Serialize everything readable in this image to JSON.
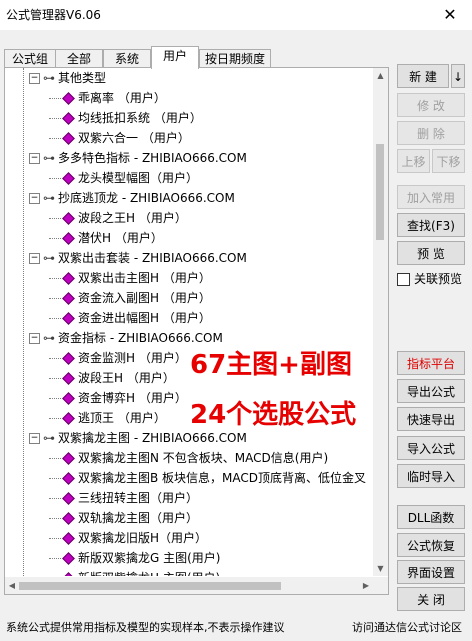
{
  "window": {
    "title": "公式管理器V6.06",
    "close_glyph": "✕"
  },
  "tabs": [
    "公式组",
    "全部",
    "系统",
    "用户",
    "按日期频度"
  ],
  "active_tab": "用户",
  "tree": [
    {
      "type": "group",
      "label": "其他类型"
    },
    {
      "type": "item",
      "label": "乖离率 （用户）"
    },
    {
      "type": "item",
      "label": "均线抵扣系统 （用户）"
    },
    {
      "type": "item",
      "label": "双紫六合一 （用户）"
    },
    {
      "type": "group",
      "label": "多多特色指标 - ZHIBIAO666.COM"
    },
    {
      "type": "item",
      "label": "龙头模型幅图（用户）"
    },
    {
      "type": "group",
      "label": "抄底逃顶龙 - ZHIBIAO666.COM"
    },
    {
      "type": "item",
      "label": "波段之王H （用户）"
    },
    {
      "type": "item",
      "label": "潜伏H （用户）"
    },
    {
      "type": "group",
      "label": "双紫出击套装 - ZHIBIAO666.COM"
    },
    {
      "type": "item",
      "label": "双紫出击主图H （用户）"
    },
    {
      "type": "item",
      "label": "资金流入副图H （用户）"
    },
    {
      "type": "item",
      "label": "资金进出幅图H （用户）"
    },
    {
      "type": "group",
      "label": "资金指标 - ZHIBIAO666.COM"
    },
    {
      "type": "item",
      "label": "资金监测H （用户）"
    },
    {
      "type": "item",
      "label": "波段王H （用户）"
    },
    {
      "type": "item",
      "label": "资金博弈H （用户）"
    },
    {
      "type": "item",
      "label": "逃顶王 （用户）"
    },
    {
      "type": "group",
      "label": "双紫擒龙主图 - ZHIBIAO666.COM"
    },
    {
      "type": "item",
      "label": "双紫擒龙主图N  不包含板块、MACD信息(用户)"
    },
    {
      "type": "item",
      "label": "双紫擒龙主图B  板块信息，MACD顶底背离、低位金叉"
    },
    {
      "type": "item",
      "label": "三线扭转主图（用户）"
    },
    {
      "type": "item",
      "label": "双轨擒龙主图（用户）"
    },
    {
      "type": "item",
      "label": "双紫擒龙旧版H（用户）"
    },
    {
      "type": "item",
      "label": "新版双紫擒龙G 主图(用户)"
    },
    {
      "type": "item",
      "label": "新版双紫擒龙H 主图(用户)"
    }
  ],
  "buttons": {
    "new": "新 建",
    "new_arrow": "↓",
    "modify": "修 改",
    "delete": "删 除",
    "move_up": "上移",
    "move_down": "下移",
    "add_common": "加入常用",
    "find": "查找(F3)",
    "preview": "预 览",
    "link_preview": "关联预览",
    "indicator_platform": "指标平台",
    "export": "导出公式",
    "quick_export": "快速导出",
    "import": "导入公式",
    "temp_import": "临时导入",
    "dll": "DLL函数",
    "restore": "公式恢复",
    "ui_settings": "界面设置",
    "close": "关 闭"
  },
  "overlay": {
    "line1": "67主图+副图",
    "line2": "24个选股公式"
  },
  "status": {
    "left": "系统公式提供常用指标及模型的实现样本,不表示操作建议",
    "right": "访问通达信公式讨论区"
  },
  "colors": {
    "accent_red": "#e60000",
    "gem": "#c000c0"
  }
}
